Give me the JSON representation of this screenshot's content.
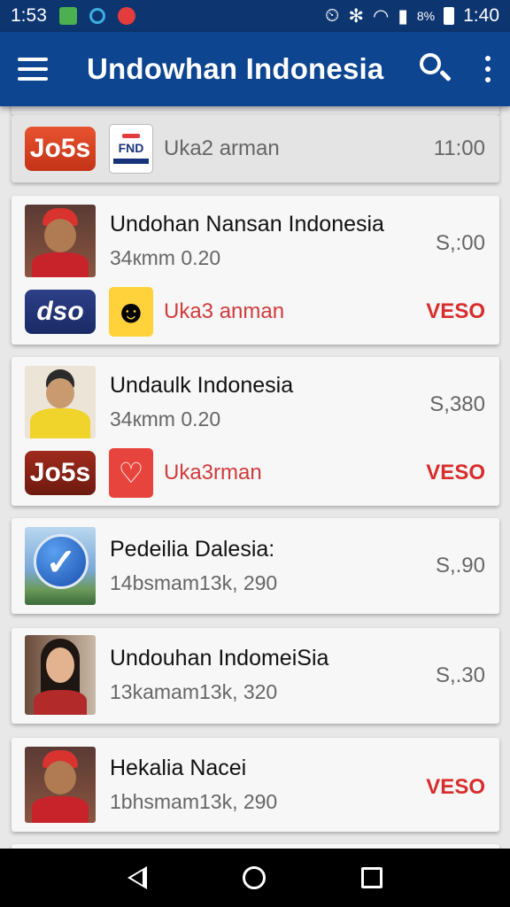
{
  "status_bar": {
    "time_left": "1:53",
    "battery_percent": "8%",
    "time_right": "1:40"
  },
  "app_bar": {
    "title": "Undowhan Indonesia",
    "menu_icon": "hamburger-menu-icon",
    "search_icon": "search-icon",
    "more_icon": "overflow-menu-icon"
  },
  "cards": [
    {
      "logo": "Jo5s",
      "badge": "FND",
      "label": "Uka2 arman",
      "value": "11:00"
    },
    {
      "name": "Undohan Nansan Indonesia",
      "meta": "34кmm 0.20",
      "value": "S,:00",
      "logo": "dso",
      "badge_icon": "smiley-icon",
      "label": "Uka3 anman",
      "action": "VESO"
    },
    {
      "name": "Undaulk Indonesia",
      "meta": "34кmm 0.20",
      "value": "S,380",
      "logo": "Jo5s",
      "badge_icon": "heart-icon",
      "label": "Uka3rman",
      "action": "VESO"
    },
    {
      "name": "Pedeilia Dalesia:",
      "meta": "14bsmam13k, 290",
      "value": "S,.90",
      "avatar_icon": "checkmark-icon"
    },
    {
      "name": "Undouhan IndomeiSia",
      "meta": "13kamam13k, 320",
      "value": "S,.30"
    },
    {
      "name": "Hekalia Nacei",
      "meta": "1bhsmam13k, 290",
      "action": "VESO"
    }
  ],
  "colors": {
    "app_bar": "#0d4590",
    "status_bar": "#0d3570",
    "accent_red": "#d92d2d"
  }
}
